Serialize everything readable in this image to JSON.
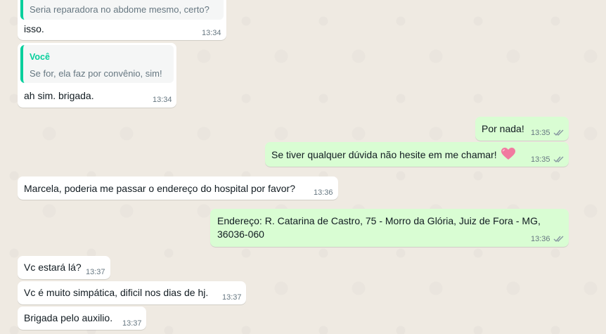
{
  "colors": {
    "wallpaper": "#efeae2",
    "incoming_bubble": "#ffffff",
    "outgoing_bubble": "#d9fdd3",
    "quote_accent": "#06cf9c",
    "read_ticks": "#8696a0",
    "timestamp": "#667781"
  },
  "messages": [
    {
      "id": "m0",
      "direction": "in",
      "quote_text": "Seria reparadora no abdome mesmo, certo?",
      "text": "isso.",
      "time": "13:34"
    },
    {
      "id": "m1",
      "direction": "in",
      "quote_author": "Você",
      "quote_text": "Se for, ela faz por convênio, sim!",
      "text": "ah sim. brigada.",
      "time": "13:34"
    },
    {
      "id": "m2",
      "direction": "out",
      "text": "Por nada!",
      "time": "13:35",
      "status_icon": "double-check-icon"
    },
    {
      "id": "m3",
      "direction": "out",
      "text": "Se tiver qualquer dúvida não hesite em me chamar!",
      "emoji": "heart-emoji",
      "time": "13:35",
      "status_icon": "double-check-icon"
    },
    {
      "id": "m4",
      "direction": "in",
      "text": "Marcela, poderia me passar o endereço do hospital por favor?",
      "time": "13:36"
    },
    {
      "id": "m5",
      "direction": "out",
      "text_line1": "Endereço: R. Catarina de Castro, 75 - Morro da Glória, Juiz de Fora - MG,",
      "text_line2": "36036-060",
      "time": "13:36",
      "status_icon": "double-check-icon"
    },
    {
      "id": "m6",
      "direction": "in",
      "text": "Vc estará lá?",
      "time": "13:37"
    },
    {
      "id": "m7",
      "direction": "in",
      "text": "Vc é muito simpática, dificil nos dias de hj.",
      "time": "13:37"
    },
    {
      "id": "m8",
      "direction": "in",
      "text": "Brigada pelo auxilio.",
      "time": "13:37"
    }
  ]
}
